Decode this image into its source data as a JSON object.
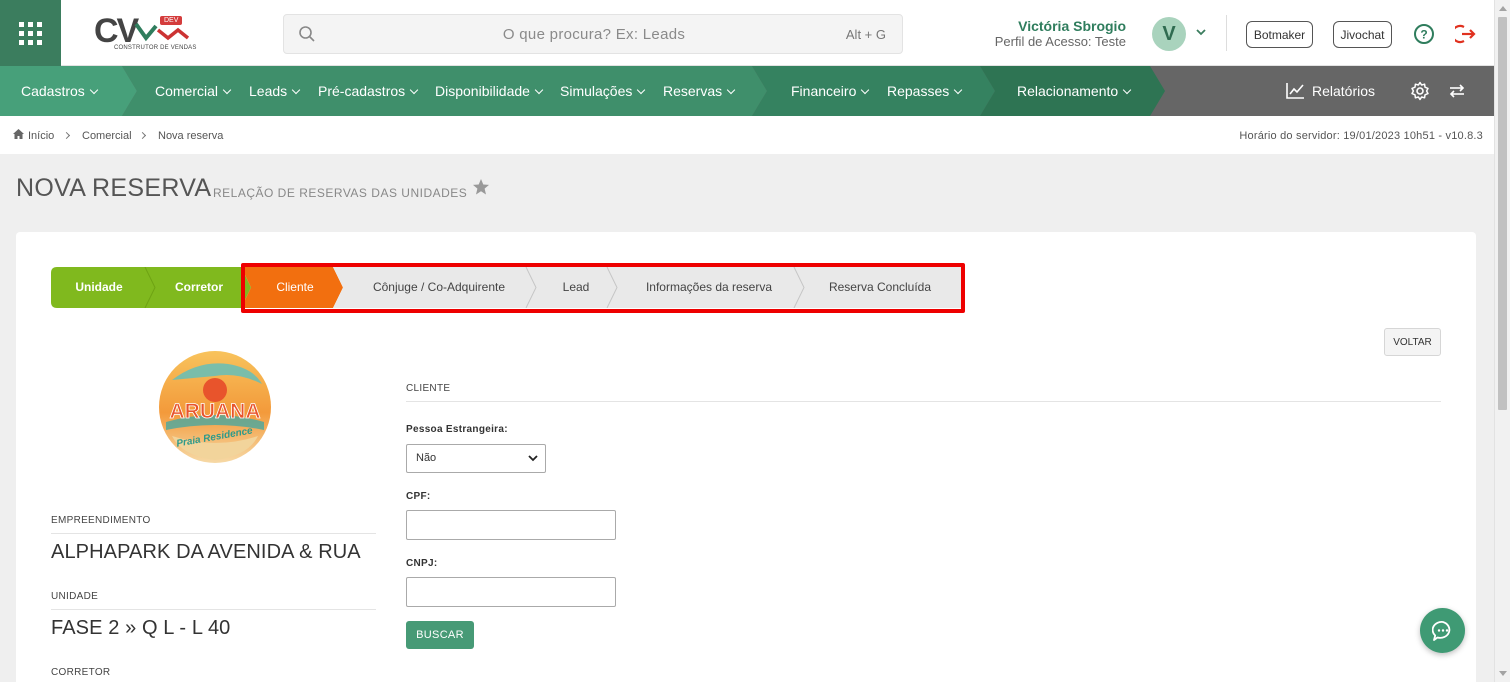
{
  "header": {
    "logo_text": "CV",
    "logo_badge": "DEV",
    "logo_sub": "CONSTRUTOR DE VENDAS",
    "search_placeholder": "O que procura? Ex: Leads",
    "search_shortcut": "Alt + G",
    "user_name": "Victória Sbrogio",
    "user_profile": "Perfil de Acesso: Teste",
    "avatar_letter": "V",
    "botmaker_label": "Botmaker",
    "jivochat_label": "Jivochat"
  },
  "nav": {
    "items": [
      {
        "label": "Cadastros"
      },
      {
        "label": "Comercial"
      },
      {
        "label": "Leads"
      },
      {
        "label": "Pré-cadastros"
      },
      {
        "label": "Disponibilidade"
      },
      {
        "label": "Simulações"
      },
      {
        "label": "Reservas"
      },
      {
        "label": "Financeiro"
      },
      {
        "label": "Repasses"
      },
      {
        "label": "Relacionamento"
      }
    ],
    "reports_label": "Relatórios"
  },
  "breadcrumb": {
    "items": [
      "Início",
      "Comercial",
      "Nova reserva"
    ],
    "server_time": "Horário do servidor: 19/01/2023 10h51 - v10.8.3"
  },
  "page": {
    "title": "NOVA RESERVA",
    "subtitle": "RELAÇÃO DE RESERVAS DAS UNIDADES"
  },
  "stepper": {
    "steps": [
      {
        "label": "Unidade",
        "state": "done"
      },
      {
        "label": "Corretor",
        "state": "done"
      },
      {
        "label": "Cliente",
        "state": "active"
      },
      {
        "label": "Cônjuge / Co-Adquirente",
        "state": "pending"
      },
      {
        "label": "Lead",
        "state": "pending"
      },
      {
        "label": "Informações da reserva",
        "state": "pending"
      },
      {
        "label": "Reserva Concluída",
        "state": "pending"
      }
    ]
  },
  "actions": {
    "back_label": "VOLTAR"
  },
  "property": {
    "logo_text_main": "ARUANA",
    "logo_text_sub": "Praia Residence",
    "empreendimento_label": "EMPREENDIMENTO",
    "empreendimento_value": "ALPHAPARK DA AVENIDA & RUA",
    "unidade_label": "UNIDADE",
    "unidade_value": "FASE 2 » Q L - L 40",
    "corretor_label": "CORRETOR"
  },
  "form": {
    "section_title": "CLIENTE",
    "foreign_label": "Pessoa Estrangeira:",
    "foreign_value": "Não",
    "cpf_label": "CPF:",
    "cpf_value": "",
    "cnpj_label": "CNPJ:",
    "cnpj_value": "",
    "search_button": "BUSCAR"
  },
  "colors": {
    "brand_green": "#3b7d5e",
    "step_done": "#80b91e",
    "step_active": "#f26f0f",
    "highlight": "#e00000"
  }
}
